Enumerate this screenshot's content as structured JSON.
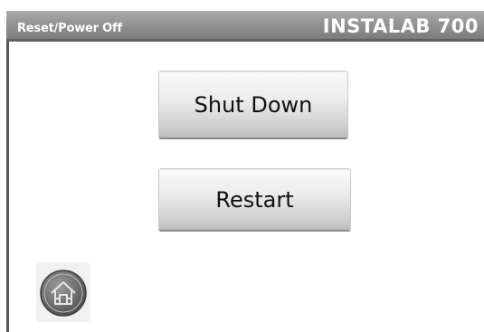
{
  "header": {
    "screen_title": "Reset/Power Off",
    "device_name": "INSTALAB 700"
  },
  "actions": {
    "shutdown_label": "Shut Down",
    "restart_label": "Restart"
  },
  "navigation": {
    "home_icon": "home-icon"
  }
}
